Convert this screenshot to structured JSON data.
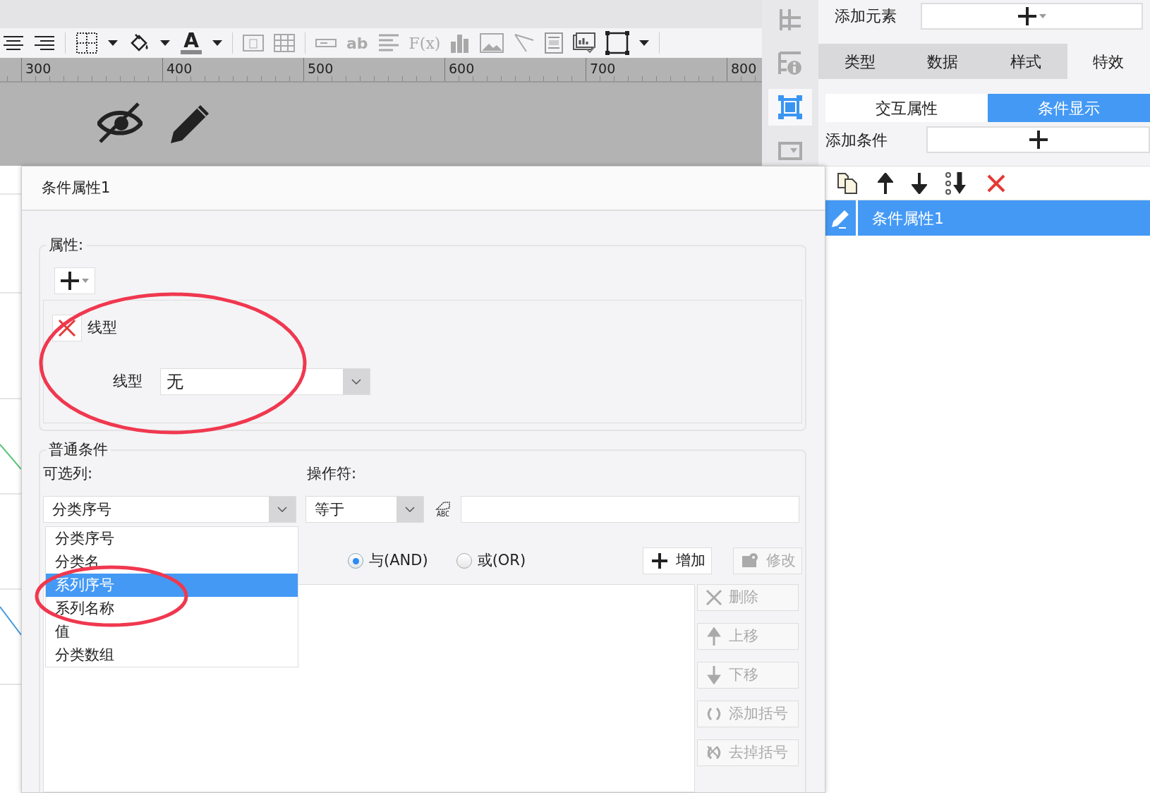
{
  "toolbar": {
    "font_color_glyph": "A",
    "glyph_labels": [
      "ab",
      "F(x)"
    ]
  },
  "ruler": {
    "labels": [
      "300",
      "400",
      "500",
      "600",
      "700",
      "800"
    ]
  },
  "side_panel": {
    "add_element_label": "添加元素",
    "tabs": [
      {
        "label": "类型",
        "selected": false
      },
      {
        "label": "数据",
        "selected": false
      },
      {
        "label": "样式",
        "selected": false
      },
      {
        "label": "特效",
        "selected": true
      }
    ],
    "sub_tabs": [
      {
        "label": "交互属性",
        "selected": false
      },
      {
        "label": "条件显示",
        "selected": true
      }
    ],
    "add_condition_label": "添加条件",
    "conditions": [
      {
        "label": "条件属性1",
        "selected": true
      }
    ]
  },
  "dialog": {
    "title": "条件属性1",
    "attributes": {
      "legend": "属性:",
      "items": [
        {
          "title": "线型",
          "field_label": "线型",
          "value": "无"
        }
      ]
    },
    "conditions": {
      "legend": "普通条件",
      "column_label": "可选列:",
      "operator_label": "操作符:",
      "column_value": "分类序号",
      "operator_value": "等于",
      "formula_glyph": "ABC",
      "column_options": [
        {
          "label": "分类序号",
          "selected": false
        },
        {
          "label": "分类名",
          "selected": false
        },
        {
          "label": "系列序号",
          "selected": true
        },
        {
          "label": "系列名称",
          "selected": false
        },
        {
          "label": "值",
          "selected": false
        },
        {
          "label": "分类数组",
          "selected": false
        }
      ],
      "logic": [
        {
          "label": "与(AND)",
          "selected": true
        },
        {
          "label": "或(OR)",
          "selected": false
        }
      ],
      "buttons": [
        {
          "kind": "add",
          "label": "增加",
          "disabled": false
        },
        {
          "kind": "edit",
          "label": "修改",
          "disabled": true
        }
      ],
      "side_buttons": [
        {
          "kind": "delete",
          "label": "删除",
          "disabled": true
        },
        {
          "kind": "up",
          "label": "上移",
          "disabled": true
        },
        {
          "kind": "down",
          "label": "下移",
          "disabled": true
        },
        {
          "kind": "bracket",
          "label": "添加括号",
          "disabled": true
        },
        {
          "kind": "unbracket",
          "label": "去掉括号",
          "disabled": true
        }
      ]
    }
  }
}
